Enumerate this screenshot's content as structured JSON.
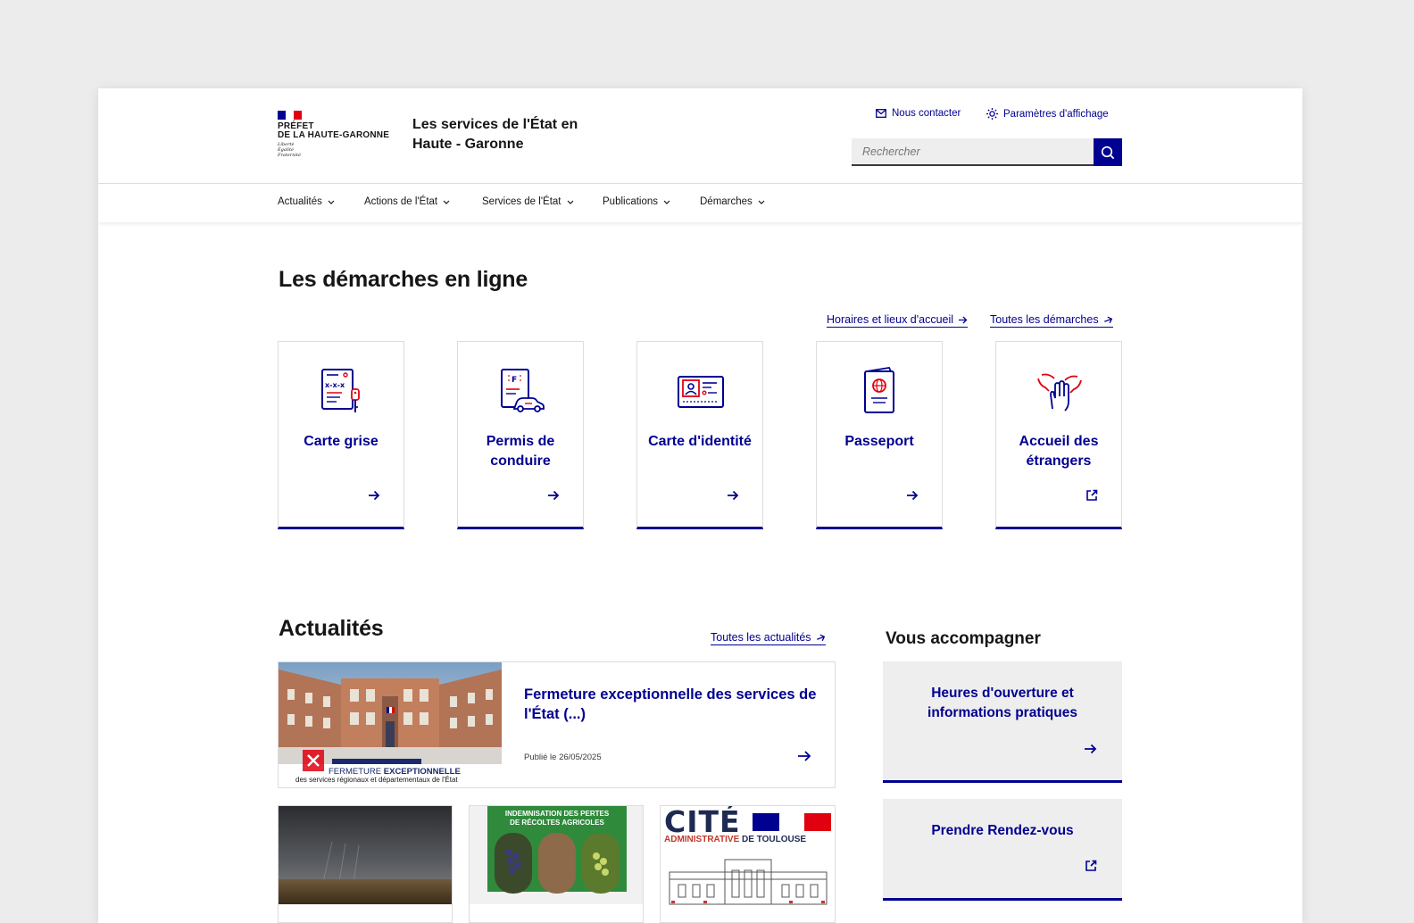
{
  "header": {
    "logo_line1": "PRÉFET",
    "logo_line2": "DE LA HAUTE-GARONNE",
    "motto": [
      "Liberté",
      "Égalité",
      "Fraternité"
    ],
    "site_title": "Les services de l'État en Haute - Garonne",
    "contact_label": "Nous contacter",
    "display_label": "Paramètres d'affichage",
    "search_placeholder": "Rechercher"
  },
  "nav": {
    "items": [
      "Actualités",
      "Actions de l'État",
      "Services de l'État",
      "Publications",
      "Démarches"
    ]
  },
  "demarches": {
    "title": "Les démarches en ligne",
    "link_horaires": "Horaires et lieux d'accueil",
    "link_toutes": "Toutes les démarches",
    "tiles": [
      {
        "label": "Carte grise",
        "icon": "car-registration-icon"
      },
      {
        "label": "Permis de conduire",
        "icon": "driving-license-icon"
      },
      {
        "label": "Carte d'identité",
        "icon": "id-card-icon"
      },
      {
        "label": "Passeport",
        "icon": "passport-icon"
      },
      {
        "label": "Accueil des étrangers",
        "icon": "foreigners-welcome-icon"
      }
    ]
  },
  "actualites": {
    "title": "Actualités",
    "link_all": "Toutes les actualités",
    "main": {
      "title": "Fermeture exceptionnelle des services de l'État (...)",
      "date": "Publié le 26/05/2025",
      "img_caption_1": "FERMETURE",
      "img_caption_bold": "EXCEPTIONNELLE",
      "img_caption_2": "des services régionaux et départementaux de l'État"
    },
    "thumb2_text_1": "INDEMNISATION DES PERTES",
    "thumb2_text_2": "DE RÉCOLTES AGRICOLES",
    "thumb3_title": "CITÉ",
    "thumb3_sub_1": "ADMINISTRATIVE",
    "thumb3_sub_2": "DE TOULOUSE"
  },
  "accompagner": {
    "title": "Vous accompagner",
    "card1": "Heures d'ouverture et informations pratiques",
    "card2": "Prendre Rendez-vous"
  },
  "colors": {
    "primary": "#000091",
    "marianne_red": "#e1000f",
    "border": "#dddddd",
    "card_bg": "#eeeeee"
  }
}
